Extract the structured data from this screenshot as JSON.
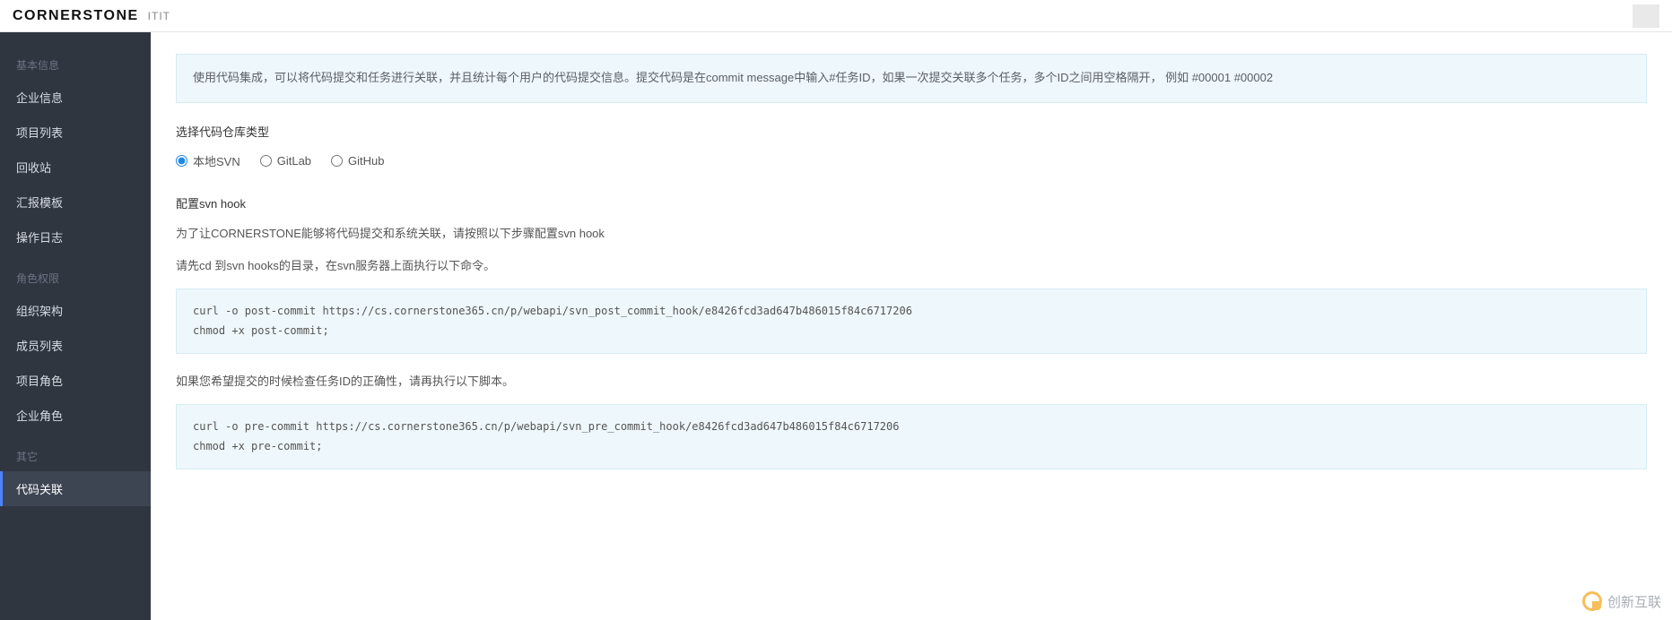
{
  "header": {
    "brand": "CORNERSTONE",
    "sub": "ITIT"
  },
  "sidebar": {
    "sections": [
      {
        "title": "基本信息",
        "items": [
          {
            "label": "企业信息",
            "active": false
          },
          {
            "label": "项目列表",
            "active": false
          },
          {
            "label": "回收站",
            "active": false
          },
          {
            "label": "汇报模板",
            "active": false
          },
          {
            "label": "操作日志",
            "active": false
          }
        ]
      },
      {
        "title": "角色权限",
        "items": [
          {
            "label": "组织架构",
            "active": false
          },
          {
            "label": "成员列表",
            "active": false
          },
          {
            "label": "项目角色",
            "active": false
          },
          {
            "label": "企业角色",
            "active": false
          }
        ]
      },
      {
        "title": "其它",
        "items": [
          {
            "label": "代码关联",
            "active": true
          }
        ]
      }
    ]
  },
  "main": {
    "banner": "使用代码集成，可以将代码提交和任务进行关联，并且统计每个用户的代码提交信息。提交代码是在commit message中输入#任务ID，如果一次提交关联多个任务，多个ID之间用空格隔开， 例如 #00001 #00002",
    "repo_type_label": "选择代码仓库类型",
    "radios": [
      {
        "label": "本地SVN",
        "checked": true
      },
      {
        "label": "GitLab",
        "checked": false
      },
      {
        "label": "GitHub",
        "checked": false
      }
    ],
    "svn_head": "配置svn hook",
    "svn_desc1": "为了让CORNERSTONE能够将代码提交和系统关联，请按照以下步骤配置svn hook",
    "svn_desc2": "请先cd 到svn hooks的目录，在svn服务器上面执行以下命令。",
    "code1": "curl -o post-commit https://cs.cornerstone365.cn/p/webapi/svn_post_commit_hook/e8426fcd3ad647b486015f84c6717206\nchmod +x post-commit;",
    "svn_desc3": "如果您希望提交的时候检查任务ID的正确性，请再执行以下脚本。",
    "code2": "curl -o pre-commit https://cs.cornerstone365.cn/p/webapi/svn_pre_commit_hook/e8426fcd3ad647b486015f84c6717206\nchmod +x pre-commit;"
  },
  "watermark": {
    "text": "创新互联"
  }
}
